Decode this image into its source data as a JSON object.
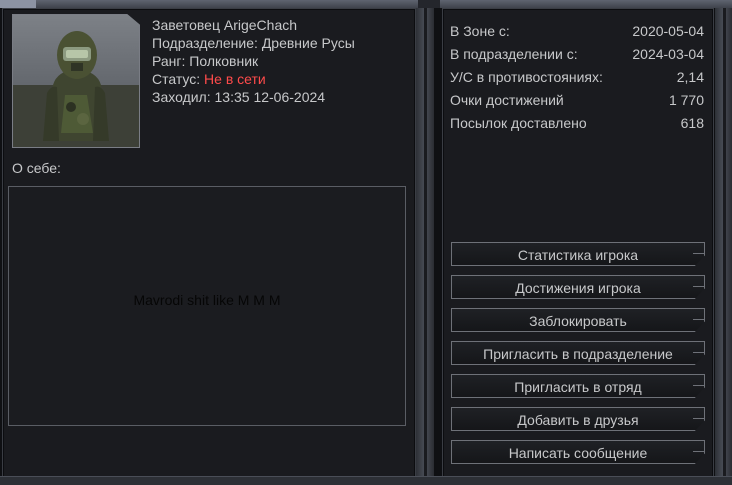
{
  "profile": {
    "name": "Заветовец ArigeChach",
    "faction_label": "Подразделение:",
    "faction": "Древние Русы",
    "rank_label": "Ранг:",
    "rank": "Полковник",
    "status_label": "Статус:",
    "status": "Не в сети",
    "status_color": "#ff4b4b",
    "last_seen_label": "Заходил:",
    "last_seen": "13:35 12-06-2024"
  },
  "about": {
    "label": "О себе:",
    "text": "Mavrodi shit like M M M"
  },
  "stats": [
    {
      "label": "В Зоне с:",
      "value": "2020-05-04"
    },
    {
      "label": "В подразделении с:",
      "value": "2024-03-04"
    },
    {
      "label": "У/С в противостояниях:",
      "value": "2,14"
    },
    {
      "label": "Очки достижений",
      "value": "1 770"
    },
    {
      "label": "Посылок доставлено",
      "value": "618"
    }
  ],
  "buttons": {
    "player_stats": "Статистика игрока",
    "achievements": "Достижения игрока",
    "block": "Заблокировать",
    "invite_faction": "Пригласить в подразделение",
    "invite_squad": "Пригласить в отряд",
    "add_friend": "Добавить в друзья",
    "send_message": "Написать сообщение"
  }
}
